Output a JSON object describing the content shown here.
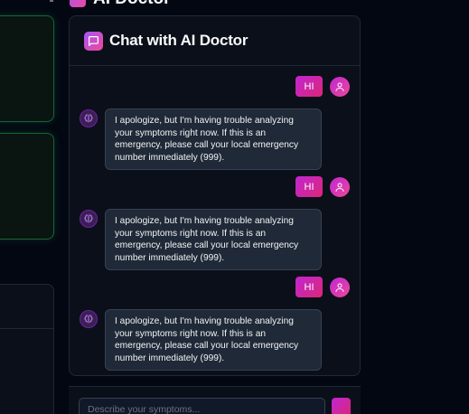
{
  "top_header": {
    "title": "AI Doctor"
  },
  "chat": {
    "title": "Chat with AI Doctor",
    "messages": [
      {
        "role": "user",
        "text": "HI"
      },
      {
        "role": "bot",
        "text": "I apologize, but I'm having trouble analyzing your symptoms right now. If this is an emergency, please call your local emergency number immediately (999)."
      },
      {
        "role": "user",
        "text": "HI"
      },
      {
        "role": "bot",
        "text": "I apologize, but I'm having trouble analyzing your symptoms right now. If this is an emergency, please call your local emergency number immediately (999)."
      },
      {
        "role": "user",
        "text": "HI"
      },
      {
        "role": "bot",
        "text": "I apologize, but I'm having trouble analyzing your symptoms right now. If this is an emergency, please call your local emergency number immediately (999)."
      }
    ]
  },
  "input": {
    "placeholder": "Describe your symptoms...",
    "value": ""
  },
  "icons": {
    "chat": "message-square-icon",
    "user": "user-icon",
    "bot": "brain-icon",
    "send": "send-icon"
  },
  "colors": {
    "accent_start": "#c026d3",
    "accent_end": "#db2777",
    "background": "#030712",
    "panel": "#0b0f19",
    "bubble": "#1f2937"
  }
}
